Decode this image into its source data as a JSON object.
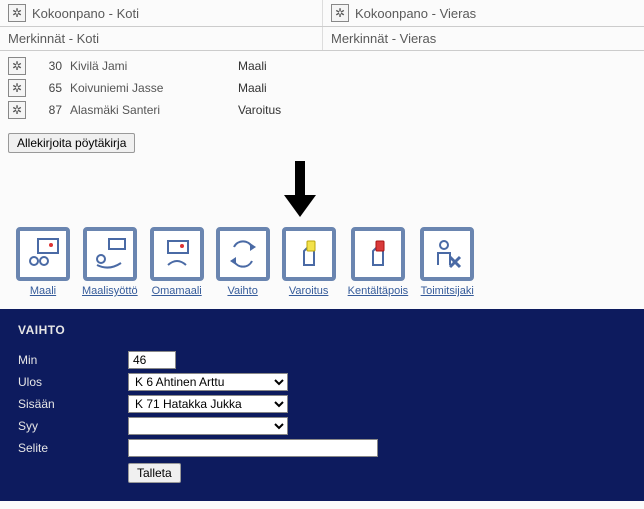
{
  "panels": {
    "home_kokoonpano": "Kokoonpano - Koti",
    "away_kokoonpano": "Kokoonpano - Vieras",
    "home_merk": "Merkinnät - Koti",
    "away_merk": "Merkinnät - Vieras"
  },
  "markings": [
    {
      "num": "30",
      "player": "Kivilä Jami",
      "event": "Maali"
    },
    {
      "num": "65",
      "player": "Koivuniemi Jasse",
      "event": "Maali"
    },
    {
      "num": "87",
      "player": "Alasmäki Santeri",
      "event": "Varoitus"
    }
  ],
  "sign_button": "Allekirjoita pöytäkirja",
  "actions": [
    {
      "key": "maali",
      "label": "Maali"
    },
    {
      "key": "maalisyotto",
      "label": "Maalisyöttö"
    },
    {
      "key": "omamaali",
      "label": "Omamaali"
    },
    {
      "key": "vaihto",
      "label": "Vaihto"
    },
    {
      "key": "varoitus",
      "label": "Varoitus"
    },
    {
      "key": "kentaltapois",
      "label": "Kentältäpois"
    },
    {
      "key": "toimitsijaki",
      "label": "Toimitsijaki"
    }
  ],
  "form": {
    "title": "VAIHTO",
    "labels": {
      "min": "Min",
      "ulos": "Ulos",
      "sisaan": "Sisään",
      "syy": "Syy",
      "selite": "Selite"
    },
    "values": {
      "min": "46",
      "ulos": "K 6 Ahtinen Arttu",
      "sisaan": "K 71 Hatakka Jukka",
      "syy": "",
      "selite": ""
    },
    "submit": "Talleta"
  }
}
